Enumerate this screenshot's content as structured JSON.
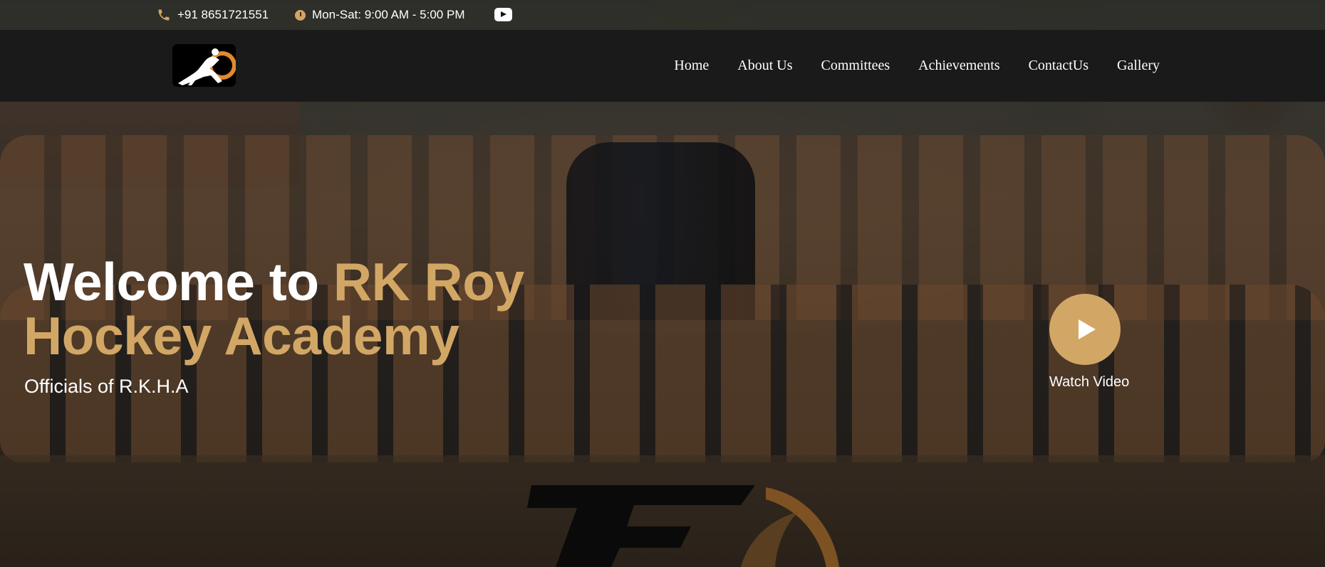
{
  "topbar": {
    "phone": "+91 8651721551",
    "hours": "Mon-Sat: 9:00 AM - 5:00 PM",
    "social_icon": "youtube-icon"
  },
  "navbar": {
    "logo_icon": "hockey-player-logo",
    "links": [
      "Home",
      "About Us",
      "Committees",
      "Achievements",
      "ContactUs",
      "Gallery"
    ]
  },
  "hero": {
    "title_line1_white": "Welcome to ",
    "title_line1_gold": "RK Roy",
    "title_line2_gold": "Hockey Academy",
    "subtitle": "Officials of R.K.H.A",
    "watch_label": "Watch Video",
    "play_icon": "play-icon"
  },
  "colors": {
    "accent": "#d2a766",
    "navbar_bg": "#1a1a1a",
    "text": "#ffffff"
  }
}
